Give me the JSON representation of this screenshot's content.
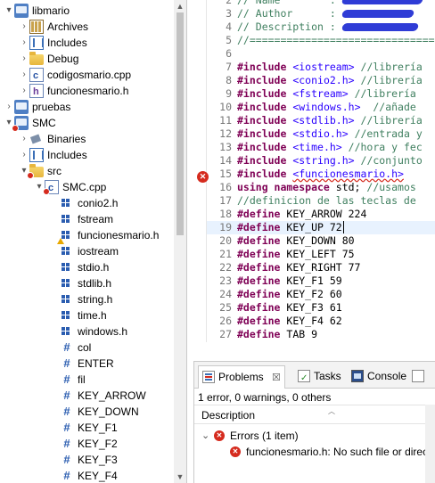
{
  "explorer": {
    "items": [
      {
        "label": "libmario",
        "twisty": "▾",
        "icon": "project-icon",
        "indent": 0
      },
      {
        "label": "Archives",
        "twisty": "›",
        "icon": "archives-icon",
        "indent": 1
      },
      {
        "label": "Includes",
        "twisty": "›",
        "icon": "includes-icon",
        "indent": 1
      },
      {
        "label": "Debug",
        "twisty": "›",
        "icon": "folder-icon",
        "indent": 1
      },
      {
        "label": "codigosmario.cpp",
        "twisty": "›",
        "icon": "cpp-file-icon",
        "indent": 1
      },
      {
        "label": "funcionesmario.h",
        "twisty": "›",
        "icon": "header-file-icon",
        "indent": 1
      },
      {
        "label": "pruebas",
        "twisty": "›",
        "icon": "project-icon",
        "indent": 0
      },
      {
        "label": "SMC",
        "twisty": "▾",
        "icon": "project-error-icon",
        "indent": 0
      },
      {
        "label": "Binaries",
        "twisty": "›",
        "icon": "binaries-icon",
        "indent": 1
      },
      {
        "label": "Includes",
        "twisty": "›",
        "icon": "includes-icon",
        "indent": 1
      },
      {
        "label": "src",
        "twisty": "▾",
        "icon": "folder-error-icon",
        "indent": 1
      },
      {
        "label": "SMC.cpp",
        "twisty": "▾",
        "icon": "cpp-file-error-icon",
        "indent": 2
      },
      {
        "label": "conio2.h",
        "twisty": "",
        "icon": "include-statement-icon",
        "indent": 3
      },
      {
        "label": "fstream",
        "twisty": "",
        "icon": "include-statement-icon",
        "indent": 3
      },
      {
        "label": "funcionesmario.h",
        "twisty": "",
        "icon": "include-statement-warning-icon",
        "indent": 3
      },
      {
        "label": "iostream",
        "twisty": "",
        "icon": "include-statement-icon",
        "indent": 3
      },
      {
        "label": "stdio.h",
        "twisty": "",
        "icon": "include-statement-icon",
        "indent": 3
      },
      {
        "label": "stdlib.h",
        "twisty": "",
        "icon": "include-statement-icon",
        "indent": 3
      },
      {
        "label": "string.h",
        "twisty": "",
        "icon": "include-statement-icon",
        "indent": 3
      },
      {
        "label": "time.h",
        "twisty": "",
        "icon": "include-statement-icon",
        "indent": 3
      },
      {
        "label": "windows.h",
        "twisty": "",
        "icon": "include-statement-icon",
        "indent": 3
      },
      {
        "label": "col",
        "twisty": "",
        "icon": "macro-icon",
        "indent": 3
      },
      {
        "label": "ENTER",
        "twisty": "",
        "icon": "macro-icon",
        "indent": 3
      },
      {
        "label": "fil",
        "twisty": "",
        "icon": "macro-icon",
        "indent": 3
      },
      {
        "label": "KEY_ARROW",
        "twisty": "",
        "icon": "macro-icon",
        "indent": 3
      },
      {
        "label": "KEY_DOWN",
        "twisty": "",
        "icon": "macro-icon",
        "indent": 3
      },
      {
        "label": "KEY_F1",
        "twisty": "",
        "icon": "macro-icon",
        "indent": 3
      },
      {
        "label": "KEY_F2",
        "twisty": "",
        "icon": "macro-icon",
        "indent": 3
      },
      {
        "label": "KEY_F3",
        "twisty": "",
        "icon": "macro-icon",
        "indent": 3
      },
      {
        "label": "KEY_F4",
        "twisty": "",
        "icon": "macro-icon",
        "indent": 3
      }
    ]
  },
  "editor": {
    "current_line": "19",
    "error_line": "15",
    "lines": [
      {
        "num": "2",
        "parts": [
          [
            "cmt",
            "// Name        : "
          ],
          [
            "blot",
            "90"
          ]
        ]
      },
      {
        "num": "3",
        "parts": [
          [
            "cmt",
            "// Author      : "
          ],
          [
            "blot",
            "80"
          ]
        ]
      },
      {
        "num": "4",
        "parts": [
          [
            "cmt",
            "// Description : "
          ],
          [
            "blot",
            "85"
          ]
        ]
      },
      {
        "num": "5",
        "parts": [
          [
            "cmt",
            "//=========================================="
          ]
        ]
      },
      {
        "num": "6",
        "parts": []
      },
      {
        "num": "7",
        "parts": [
          [
            "kw",
            "#include"
          ],
          [
            "txt",
            " "
          ],
          [
            "hdr",
            "<iostream>"
          ],
          [
            "txt",
            " "
          ],
          [
            "cmt",
            "//librería"
          ]
        ]
      },
      {
        "num": "8",
        "parts": [
          [
            "kw",
            "#include"
          ],
          [
            "txt",
            " "
          ],
          [
            "hdr",
            "<conio2.h>"
          ],
          [
            "txt",
            " "
          ],
          [
            "cmt",
            "//librería"
          ]
        ]
      },
      {
        "num": "9",
        "parts": [
          [
            "kw",
            "#include"
          ],
          [
            "txt",
            " "
          ],
          [
            "hdr",
            "<fstream>"
          ],
          [
            "txt",
            " "
          ],
          [
            "cmt",
            "//librería"
          ]
        ]
      },
      {
        "num": "10",
        "parts": [
          [
            "kw",
            "#include"
          ],
          [
            "txt",
            " "
          ],
          [
            "hdr",
            "<windows.h>"
          ],
          [
            "txt",
            "  "
          ],
          [
            "cmt",
            "//añade"
          ]
        ]
      },
      {
        "num": "11",
        "parts": [
          [
            "kw",
            "#include"
          ],
          [
            "txt",
            " "
          ],
          [
            "hdr",
            "<stdlib.h>"
          ],
          [
            "txt",
            " "
          ],
          [
            "cmt",
            "//librería"
          ]
        ]
      },
      {
        "num": "12",
        "parts": [
          [
            "kw",
            "#include"
          ],
          [
            "txt",
            " "
          ],
          [
            "hdr",
            "<stdio.h>"
          ],
          [
            "txt",
            " "
          ],
          [
            "cmt",
            "//entrada y"
          ]
        ]
      },
      {
        "num": "13",
        "parts": [
          [
            "kw",
            "#include"
          ],
          [
            "txt",
            " "
          ],
          [
            "hdr",
            "<time.h>"
          ],
          [
            "txt",
            " "
          ],
          [
            "cmt",
            "//hora y fec"
          ]
        ]
      },
      {
        "num": "14",
        "parts": [
          [
            "kw",
            "#include"
          ],
          [
            "txt",
            " "
          ],
          [
            "hdr",
            "<string.h>"
          ],
          [
            "txt",
            " "
          ],
          [
            "cmt",
            "//conjunto"
          ]
        ]
      },
      {
        "num": "15",
        "parts": [
          [
            "kw",
            "#include"
          ],
          [
            "txt",
            " "
          ],
          [
            "hdr err",
            "<funcionesmario.h>"
          ]
        ]
      },
      {
        "num": "16",
        "parts": [
          [
            "kw",
            "using namespace"
          ],
          [
            "txt",
            " std; "
          ],
          [
            "cmt",
            "//usamos"
          ]
        ]
      },
      {
        "num": "17",
        "parts": [
          [
            "cmt",
            "//definicion de las teclas de"
          ]
        ]
      },
      {
        "num": "18",
        "parts": [
          [
            "kw",
            "#define"
          ],
          [
            "txt",
            " KEY_ARROW 224"
          ]
        ]
      },
      {
        "num": "19",
        "parts": [
          [
            "kw",
            "#define"
          ],
          [
            "txt",
            " KEY_UP 72"
          ],
          [
            "cursor",
            ""
          ]
        ]
      },
      {
        "num": "20",
        "parts": [
          [
            "kw",
            "#define"
          ],
          [
            "txt",
            " KEY_DOWN 80"
          ]
        ]
      },
      {
        "num": "21",
        "parts": [
          [
            "kw",
            "#define"
          ],
          [
            "txt",
            " KEY_LEFT 75"
          ]
        ]
      },
      {
        "num": "22",
        "parts": [
          [
            "kw",
            "#define"
          ],
          [
            "txt",
            " KEY_RIGHT 77"
          ]
        ]
      },
      {
        "num": "23",
        "parts": [
          [
            "kw",
            "#define"
          ],
          [
            "txt",
            " KEY_F1 59"
          ]
        ]
      },
      {
        "num": "24",
        "parts": [
          [
            "kw",
            "#define"
          ],
          [
            "txt",
            " KEY_F2 60"
          ]
        ]
      },
      {
        "num": "25",
        "parts": [
          [
            "kw",
            "#define"
          ],
          [
            "txt",
            " KEY_F3 61"
          ]
        ]
      },
      {
        "num": "26",
        "parts": [
          [
            "kw",
            "#define"
          ],
          [
            "txt",
            " KEY_F4 62"
          ]
        ]
      },
      {
        "num": "27",
        "parts": [
          [
            "kw",
            "#define"
          ],
          [
            "txt",
            " TAB 9"
          ]
        ]
      }
    ]
  },
  "problems": {
    "tabs": [
      {
        "label": "Problems",
        "icon": "problems-icon",
        "close": "☒",
        "active": true
      },
      {
        "label": "Tasks",
        "icon": "tasks-icon",
        "close": "",
        "active": false
      },
      {
        "label": "Console",
        "icon": "console-icon",
        "close": "",
        "active": false
      },
      {
        "label": "",
        "icon": "properties-icon",
        "close": "",
        "active": false
      }
    ],
    "summary": "1 error, 0 warnings, 0 others",
    "column_description": "Description",
    "group_label": "Errors (1 item)",
    "error_message": "funcionesmario.h: No such file or direct"
  },
  "colors": {
    "keyword": "#7f0055",
    "string_header": "#2a00ff",
    "comment": "#3f7f5f",
    "error": "#d52b1e",
    "current_line": "#e8f2fe"
  }
}
